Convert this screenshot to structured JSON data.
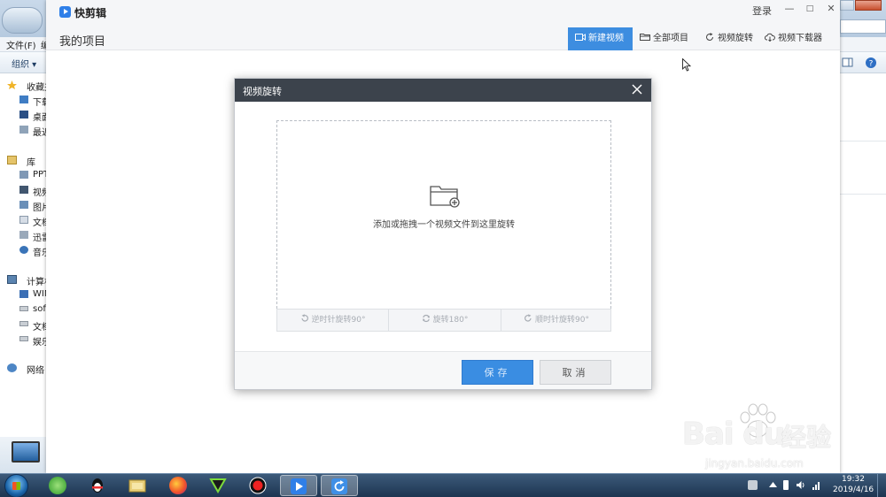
{
  "explorer": {
    "menu": {
      "file": "文件(F)",
      "edit": "编"
    },
    "toolbar": {
      "organize": "组织 ▾"
    },
    "sidebar": {
      "favorites": "收藏夹",
      "downloads": "下载",
      "desktop": "桌面",
      "recent": "最近",
      "libraries": "库",
      "ppt": "PPT",
      "videos": "视频",
      "pictures": "图片",
      "documents": "文档",
      "xunlei": "迅雷",
      "music": "音乐",
      "computer": "计算机",
      "drive_win": "WIN",
      "drive_soft": "soft",
      "drive_docs": "文档",
      "drive_ent": "娱乐",
      "network": "网络"
    }
  },
  "app": {
    "name": "快剪辑",
    "login": "登录",
    "window_controls": {
      "minimize": "—",
      "maximize": "□",
      "close": "✕"
    },
    "page_title": "我的项目",
    "tabs": [
      {
        "label": "新建视频",
        "icon": "video-camera-icon",
        "active": true
      },
      {
        "label": "全部项目",
        "icon": "folder-icon",
        "active": false
      },
      {
        "label": "视频旋转",
        "icon": "rotate-icon",
        "active": false
      },
      {
        "label": "视频下载器",
        "icon": "cloud-download-icon",
        "active": false
      }
    ]
  },
  "dialog": {
    "title": "视频旋转",
    "drop_hint": "添加或拖拽一个视频文件到这里旋转",
    "rotate_buttons": {
      "ccw": "逆时针旋转90°",
      "r180": "旋转180°",
      "cw": "顺时针旋转90°"
    },
    "save": "保存",
    "cancel": "取消"
  },
  "watermark": {
    "brand": "Bai du",
    "cn": "经验",
    "url": "jingyan.baidu.com"
  },
  "taskbar": {
    "apps": [
      "360安全浏览器",
      "QQ",
      "资源管理器",
      "Firefox",
      "剪辑软件",
      "录屏",
      "快剪辑",
      "视频旋转"
    ],
    "clock_time": "19:32",
    "clock_date": "2019/4/16"
  },
  "colors": {
    "accent": "#3d8de0",
    "dialog_header": "#3c434c",
    "taskbar": "#1d3551"
  }
}
